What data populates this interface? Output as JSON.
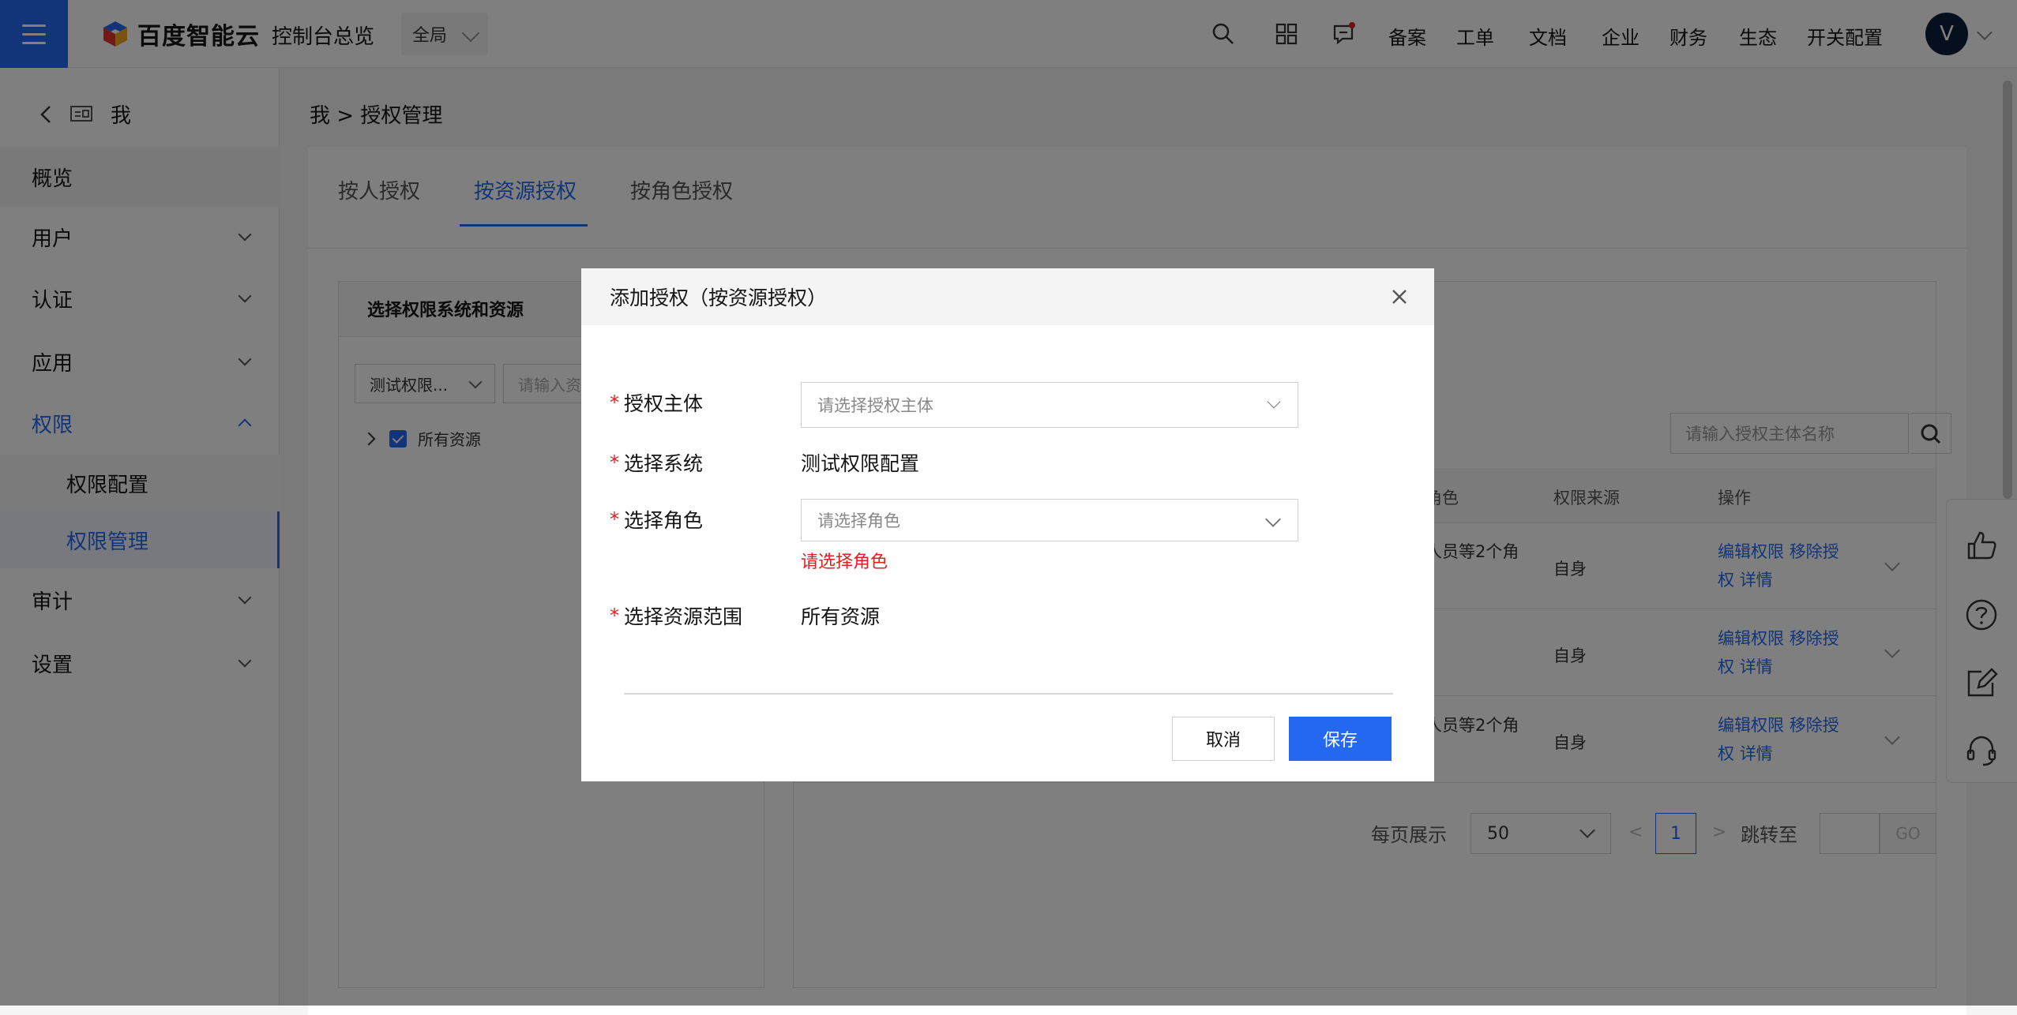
{
  "topbar": {
    "brand": "百度智能云",
    "console_title": "控制台总览",
    "region": "全局",
    "nav": [
      "备案",
      "工单",
      "文档",
      "企业",
      "财务",
      "生态",
      "开关配置"
    ],
    "avatar_initial": "V",
    "accent": "#2468f2"
  },
  "sidebar": {
    "back_title": "我",
    "items": {
      "overview": "概览",
      "users": "用户",
      "auth": "认证",
      "apps": "应用",
      "perm": "权限",
      "perm_config": "权限配置",
      "perm_manage": "权限管理",
      "audit": "审计",
      "settings": "设置"
    }
  },
  "main": {
    "breadcrumb": "我 > 授权管理",
    "tabs": [
      "按人授权",
      "按资源授权",
      "按角色授权"
    ],
    "left_panel": {
      "title": "选择权限系统和资源",
      "system_select": "测试权限...",
      "resource_search_placeholder": "请输入资",
      "tree_root": "所有资源"
    },
    "right_panel": {
      "search_placeholder": "请输入授权主体名称",
      "columns": [
        "角色",
        "权限来源",
        "操作"
      ],
      "rows": [
        {
          "role": "人员等2个角",
          "source": "自身",
          "op1": "编辑权限",
          "op2": "移除授权",
          "op3": "详情"
        },
        {
          "role": "",
          "source": "自身",
          "op1": "编辑权限",
          "op2": "移除授权",
          "op3": "详情"
        },
        {
          "role": "人员等2个角",
          "source": "自身",
          "op1": "编辑权限",
          "op2": "移除授权",
          "op3": "详情"
        }
      ]
    },
    "pager": {
      "per_page_label": "每页展示",
      "per_page": "50",
      "prev": "<",
      "current": "1",
      "next": ">",
      "jump_label": "跳转至",
      "go": "GO"
    }
  },
  "modal": {
    "title": "添加授权（按资源授权）",
    "fields": {
      "subject_label": "授权主体",
      "subject_placeholder": "请选择授权主体",
      "system_label": "选择系统",
      "system_value": "测试权限配置",
      "role_label": "选择角色",
      "role_placeholder": "请选择角色",
      "role_error": "请选择角色",
      "scope_label": "选择资源范围",
      "scope_value": "所有资源"
    },
    "required_mark": "*",
    "cancel": "取消",
    "save": "保存"
  },
  "icons": [
    "menu-icon",
    "search-icon",
    "apps-grid-icon",
    "message-icon",
    "back-arrow-icon",
    "thumbs-up-icon",
    "help-icon",
    "edit-icon",
    "headset-icon",
    "close-icon"
  ]
}
